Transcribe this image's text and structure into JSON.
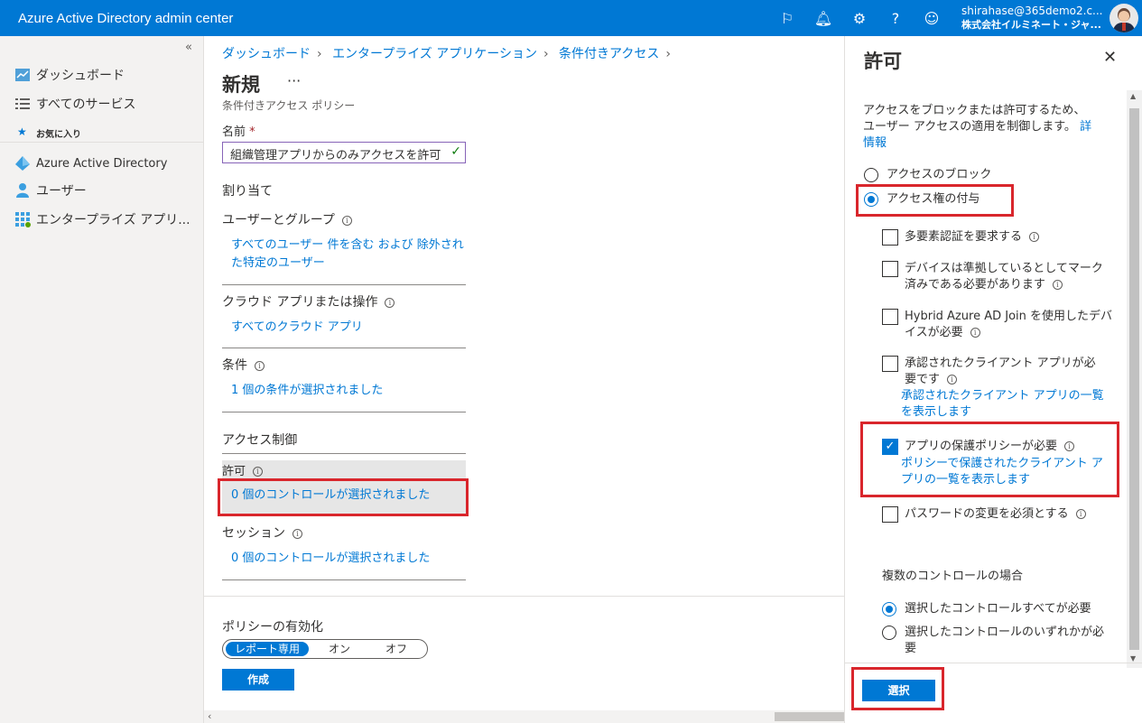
{
  "topbar": {
    "title": "Azure Active Directory admin center",
    "user_email": "shirahase@365demo2.c...",
    "user_org": "株式会社イルミネート・ジャ..."
  },
  "leftnav": {
    "collapse_icon": "«",
    "items": [
      {
        "label": "ダッシュボード",
        "icon": "dashboard-icon"
      },
      {
        "label": "すべてのサービス",
        "icon": "list-icon"
      }
    ],
    "favorites_label": "お気に入り",
    "favorites": [
      {
        "label": "Azure Active Directory",
        "icon": "aad-icon"
      },
      {
        "label": "ユーザー",
        "icon": "user-icon"
      },
      {
        "label": "エンタープライズ アプリ...",
        "icon": "apps-grid-icon"
      }
    ]
  },
  "main": {
    "breadcrumb": [
      "ダッシュボード",
      "エンタープライズ アプリケーション",
      "条件付きアクセス"
    ],
    "title": "新規",
    "more": "···",
    "subtitle": "条件付きアクセス ポリシー",
    "name_label": "名前",
    "required_mark": "*",
    "name_value": "組織管理アプリからのみアクセスを許可",
    "assign_heading": "割り当て",
    "users_heading": "ユーザーとグループ",
    "users_link_1": "すべてのユーザー 件を含む および 除外され",
    "users_link_2": "た特定のユーザー",
    "cloud_heading": "クラウド アプリまたは操作",
    "cloud_link": "すべてのクラウド アプリ",
    "conditions_heading": "条件",
    "conditions_link": "1 個の条件が選択されました",
    "access_heading": "アクセス制御",
    "grant_heading": "許可",
    "grant_link": "0 個のコントロールが選択されました",
    "session_heading": "セッション",
    "session_link": "0 個のコントロールが選択されました",
    "enable_heading": "ポリシーの有効化",
    "toggle_options": [
      "レポート専用",
      "オン",
      "オフ"
    ],
    "create_button": "作成"
  },
  "panel": {
    "title": "許可",
    "close": "✕",
    "desc_1": "アクセスをブロックまたは許可するため、",
    "desc_2": "ユーザー アクセスの適用を制御します。",
    "desc_link_1": "詳",
    "desc_link_2": "情報",
    "block_label": "アクセスのブロック",
    "grant_label": "アクセス権の付与",
    "mfa_label": "多要素認証を要求する",
    "compliant_label_1": "デバイスは準拠しているとしてマーク",
    "compliant_label_2": "済みである必要があります",
    "hybrid_label_1": "Hybrid Azure AD Join を使用したデバ",
    "hybrid_label_2": "イスが必要",
    "approved_label_1": "承認されたクライアント アプリが必",
    "approved_label_2": "要です",
    "approved_link_1": "承認されたクライアント アプリの一覧",
    "approved_link_2": "を表示します",
    "protection_label": "アプリの保護ポリシーが必要",
    "protection_link_1": "ポリシーで保護されたクライアント ア",
    "protection_link_2": "プリの一覧を表示します",
    "password_label": "パスワードの変更を必須とする",
    "multi_heading": "複数のコントロールの場合",
    "require_all": "選択したコントロールすべてが必要",
    "require_one_1": "選択したコントロールのいずれかが必",
    "require_one_2": "要",
    "select_button": "選択"
  },
  "colors": {
    "accent": "#0078d4",
    "highlight_red": "#d9262c"
  }
}
